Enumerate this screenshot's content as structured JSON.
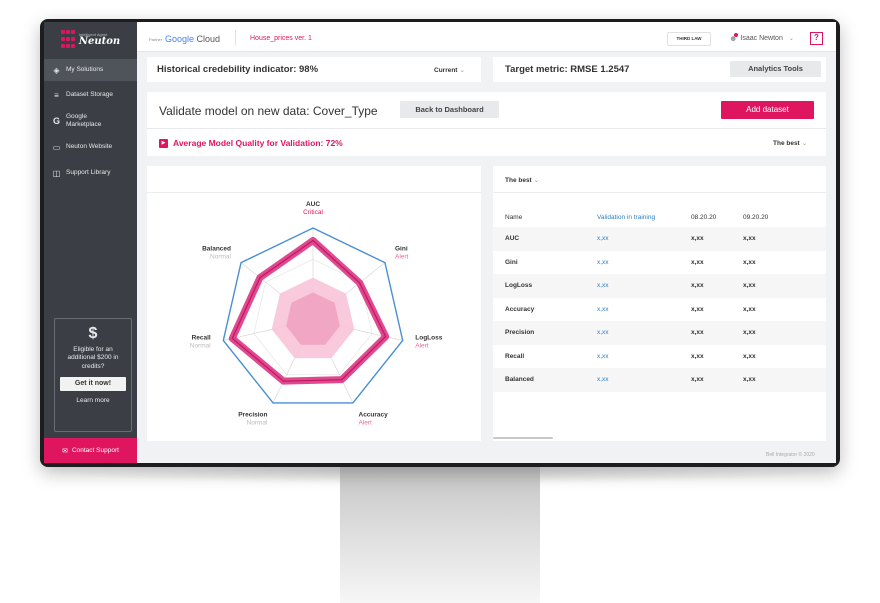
{
  "sidebar": {
    "brand_sub": "Intelligent Agent",
    "brand_name": "Neuton",
    "items": [
      {
        "label": "My Solutions",
        "icon": "layers-icon"
      },
      {
        "label": "Dataset Storage",
        "icon": "stack-icon"
      },
      {
        "label": "Google Marketplace",
        "icon": "google-g-icon"
      },
      {
        "label": "Neuton Website",
        "icon": "monitor-icon"
      },
      {
        "label": "Support Library",
        "icon": "book-icon"
      }
    ],
    "promo": {
      "symbol": "$",
      "text": "Eligible for an additional $200 in credits?",
      "button": "Get it now!",
      "link": "Learn more"
    },
    "contact": "Contact Support"
  },
  "topbar": {
    "partner": "Partner",
    "cloud_word1": "Google",
    "cloud_word2": "Cloud",
    "project": "House_prices ver. 1",
    "third_law": "THIRD LAW",
    "user": "Isaac Newton",
    "help": "?"
  },
  "kpi": {
    "credibility": "Historical credebility indicator: 98%",
    "credibility_select": "Current",
    "target": "Target metric: RMSE 1.2547",
    "analytics": "Analytics Tools"
  },
  "validate": {
    "title": "Validate model on new data: Cover_Type",
    "back": "Back to Dashboard",
    "add": "Add dataset",
    "quality": "Average Model Quality for Validation: 72%",
    "best": "The best"
  },
  "radar": {
    "axes": [
      {
        "name": "AUC",
        "status": "Critical",
        "value": 0.96
      },
      {
        "name": "Gini",
        "status": "Alert",
        "value": 0.72
      },
      {
        "name": "LogLoss",
        "status": "Alert",
        "value": 0.9
      },
      {
        "name": "Accuracy",
        "status": "Alert",
        "value": 0.8
      },
      {
        "name": "Precision",
        "status": "Normal",
        "value": 0.82
      },
      {
        "name": "Recall",
        "status": "Normal",
        "value": 1.0
      },
      {
        "name": "Balanced",
        "status": "Normal",
        "value": 0.82
      }
    ],
    "status_colors": {
      "Critical": "#e0155f",
      "Alert": "#e86a9a",
      "Normal": "#bbbbbb"
    }
  },
  "table": {
    "filter": "The best",
    "headers": [
      "Name",
      "Validation in training",
      "08.20.20",
      "09.20.20"
    ],
    "rows": [
      [
        "AUC",
        "x,xx",
        "x,xx",
        "x,xx"
      ],
      [
        "Gini",
        "x,xx",
        "x,xx",
        "x,xx"
      ],
      [
        "LogLoss",
        "x,xx",
        "x,xx",
        "x,xx"
      ],
      [
        "Accuracy",
        "x,xx",
        "x,xx",
        "x,xx"
      ],
      [
        "Precision",
        "x,xx",
        "x,xx",
        "x,xx"
      ],
      [
        "Recall",
        "x,xx",
        "x,xx",
        "x,xx"
      ],
      [
        "Balanced",
        "x,xx",
        "x,xx",
        "x,xx"
      ]
    ]
  },
  "footer": "Bell Integrator © 2020",
  "colors": {
    "accent": "#e0155f",
    "link": "#2d7fc1",
    "sidebar": "#3b3f45",
    "outline": "#4a8fd1"
  }
}
